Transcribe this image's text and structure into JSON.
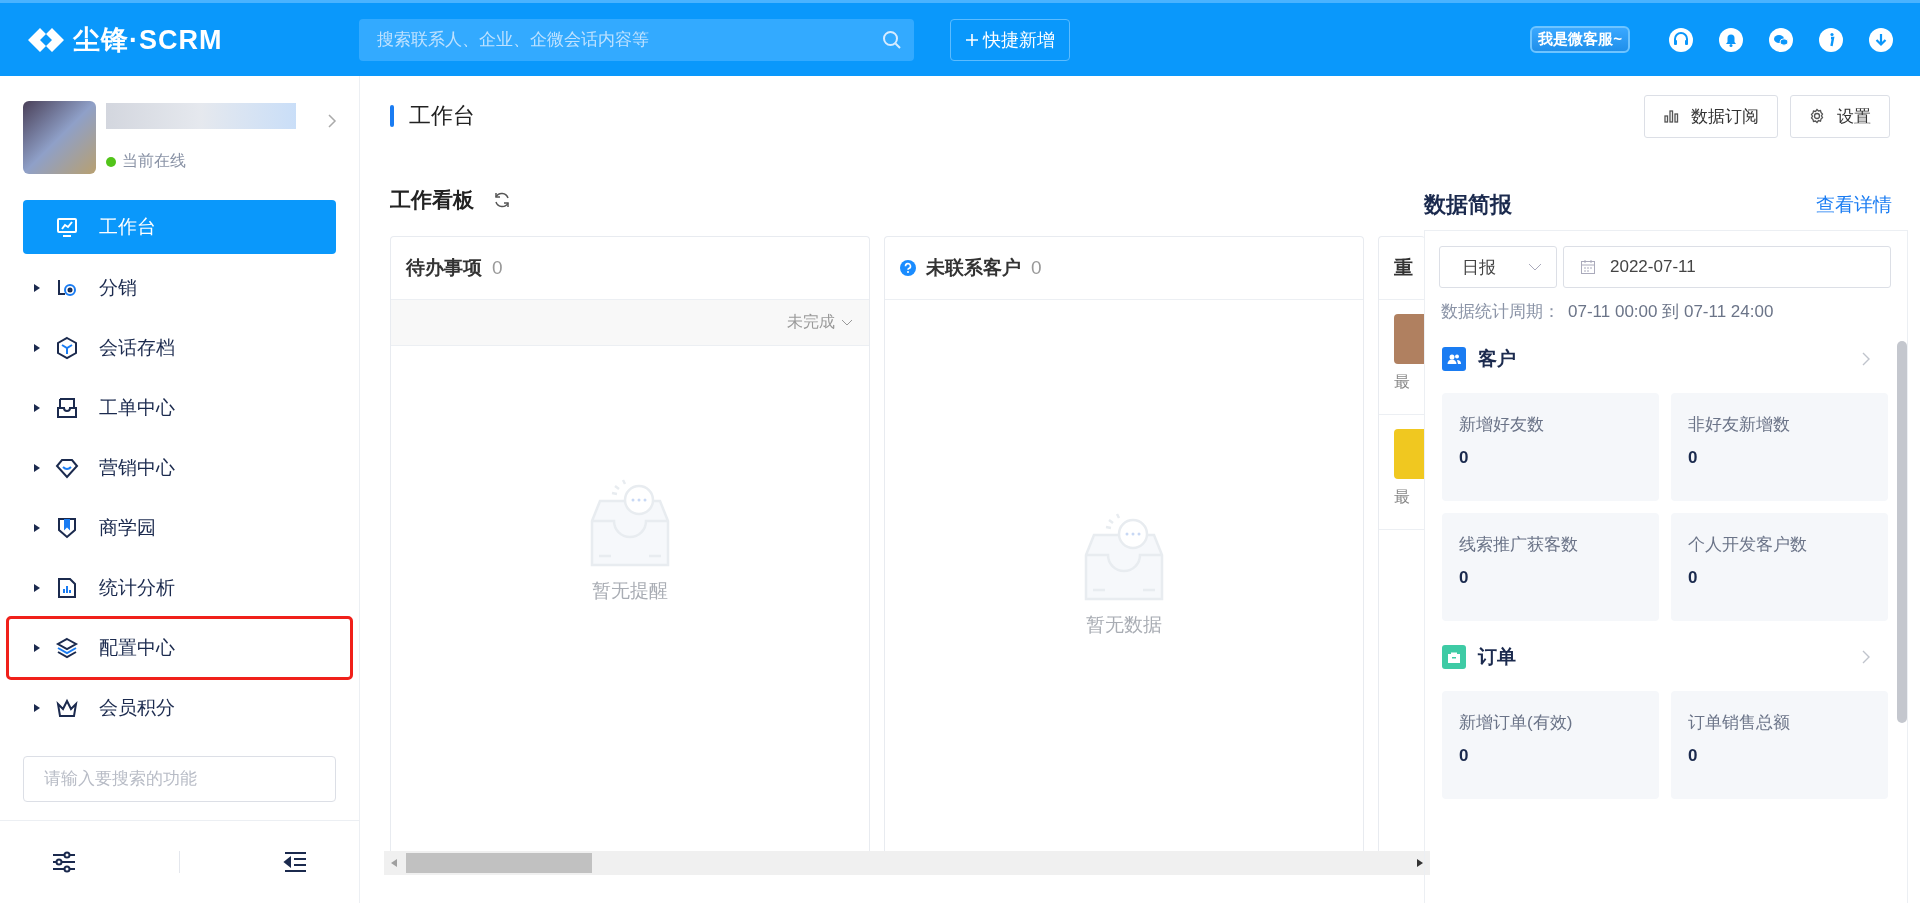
{
  "header": {
    "logo": "尘锋·SCRM",
    "search": {
      "placeholder": "搜索联系人、企业、企微会话内容等"
    },
    "quick_add": "快捷新增",
    "service_tag": "我是微客服~"
  },
  "sidebar": {
    "status": "当前在线",
    "online": true,
    "items": [
      {
        "label": "工作台",
        "selected": true,
        "highlighted": false
      },
      {
        "label": "分销",
        "selected": false,
        "expanded": false,
        "highlighted": false
      },
      {
        "label": "会话存档",
        "selected": false,
        "expanded": false,
        "highlighted": false
      },
      {
        "label": "工单中心",
        "selected": false,
        "expanded": false,
        "highlighted": false
      },
      {
        "label": "营销中心",
        "selected": false,
        "expanded": false,
        "highlighted": false
      },
      {
        "label": "商学园",
        "selected": false,
        "expanded": false,
        "highlighted": false
      },
      {
        "label": "统计分析",
        "selected": false,
        "expanded": false,
        "highlighted": false
      },
      {
        "label": "配置中心",
        "selected": false,
        "expanded": false,
        "highlighted": true
      },
      {
        "label": "会员积分",
        "selected": false,
        "expanded": false,
        "highlighted": false
      }
    ],
    "search": {
      "placeholder": "请输入要搜索的功能"
    }
  },
  "main": {
    "title": "工作台",
    "buttons": [
      "数据订阅",
      "设置"
    ],
    "board": {
      "title": "工作看板",
      "columns": [
        {
          "title": "待办事项",
          "count": "0",
          "help": false,
          "filter": "未完成",
          "empty": "暂无提醒"
        },
        {
          "title": "未联系客户",
          "count": "0",
          "help": true,
          "empty": "暂无数据"
        },
        {
          "title": "重",
          "help": false,
          "rows": [
            {
              "text": "最"
            },
            {
              "text": "最"
            }
          ]
        }
      ]
    }
  },
  "report": {
    "title": "数据简报",
    "link": "查看详情",
    "period_select": "日报",
    "date": "2022-07-11",
    "period_label": "数据统计周期：",
    "period_value": "07-11 00:00 到 07-11 24:00",
    "sections": [
      {
        "title": "客户",
        "color": "#1a7cf2",
        "stats": [
          {
            "label": "新增好友数",
            "value": "0"
          },
          {
            "label": "非好友新增数",
            "value": "0"
          },
          {
            "label": "线索推广获客数",
            "value": "0"
          },
          {
            "label": "个人开发客户数",
            "value": "0"
          }
        ]
      },
      {
        "title": "订单",
        "color": "#3ecba5",
        "stats": [
          {
            "label": "新增订单(有效)",
            "value": "0"
          },
          {
            "label": "订单销售总额",
            "value": "0"
          }
        ]
      }
    ]
  }
}
